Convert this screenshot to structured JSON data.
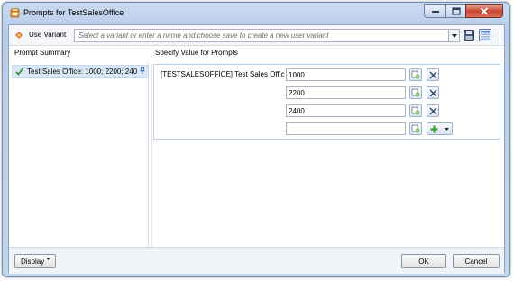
{
  "window": {
    "title": "Prompts for TestSalesOffice",
    "controls": {
      "minimize": "minimize",
      "maximize": "maximize",
      "close": "close"
    }
  },
  "variant": {
    "label": "Use Variant",
    "placeholder": "Select a variant or enter a name and choose save to create a new user variant"
  },
  "columns": {
    "left": "Prompt Summary",
    "right": "Specify Value for Prompts"
  },
  "summary": {
    "items": [
      {
        "label": "Test Sales Office: 1000; 2200; 240"
      }
    ]
  },
  "prompt": {
    "label": "[TESTSALESOFFICE] Test  Sales Offic",
    "values": [
      "1000",
      "2200",
      "2400",
      ""
    ]
  },
  "footer": {
    "display_label": "Display",
    "ok_label": "OK",
    "cancel_label": "Cancel"
  },
  "colors": {
    "accent": "#3b6fb6",
    "selection": "#dbe8f7",
    "close_red": "#c9462f",
    "titlebar": "#c4d6ec"
  },
  "icons": {
    "app": "prompt-icon",
    "variant": "variant-icon",
    "save": "save-icon",
    "layout": "layout-icon",
    "check": "check-icon",
    "pin": "pin-icon",
    "value_help": "value-help-icon",
    "remove": "remove-icon",
    "add": "add-icon"
  }
}
